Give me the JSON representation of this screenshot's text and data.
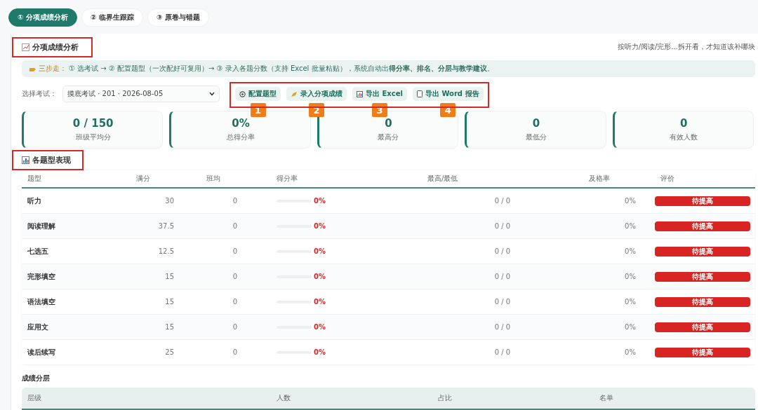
{
  "tabs": [
    {
      "label": "① 分项成绩分析",
      "selected": true
    },
    {
      "label": "② 临界生跟踪",
      "selected": false
    },
    {
      "label": "③ 原卷与错题",
      "selected": false
    }
  ],
  "panel": {
    "title": "分项成绩分析",
    "subtitle": "按听力/阅读/完形...拆开看，才知道该补哪块",
    "notice": {
      "lead": "三步走：",
      "text": "① 选考试 → ② 配置题型（一次配好可复用）→ ③ 录入各题分数（支持 Excel 批量粘贴），系统自动出**得分率、排名、分层与教学建议**。"
    },
    "exam_label": "选择考试：",
    "exam_value": "摸底考试 · 201 · 2026-08-05",
    "actions": [
      {
        "label": "配置题型",
        "kind": "config",
        "step": "1"
      },
      {
        "label": "录入分项成绩",
        "kind": "enter",
        "step": "2"
      },
      {
        "label": "导出 Excel",
        "kind": "excel",
        "step": "3"
      },
      {
        "label": "导出 Word 报告",
        "kind": "word",
        "step": "4"
      }
    ],
    "stats": [
      {
        "value": "0 / 150",
        "label": "班级平均分"
      },
      {
        "value": "0%",
        "label": "总得分率"
      },
      {
        "value": "0",
        "label": "最高分"
      },
      {
        "value": "0",
        "label": "最低分"
      },
      {
        "value": "0",
        "label": "有效人数"
      }
    ],
    "section_title": "各题型表现",
    "table": {
      "columns": [
        "题型",
        "满分",
        "班均",
        "得分率",
        "最高/最低",
        "及格率",
        "评价"
      ],
      "rows": [
        {
          "name": "听力",
          "full": "30",
          "avg": "0",
          "level": 0,
          "rate": "0%",
          "maxmin": "0 / 0",
          "pass": "0%",
          "verdict": "待提高"
        },
        {
          "name": "阅读理解",
          "full": "37.5",
          "avg": "0",
          "level": 0,
          "rate": "0%",
          "maxmin": "0 / 0",
          "pass": "0%",
          "verdict": "待提高"
        },
        {
          "name": "七选五",
          "full": "12.5",
          "avg": "0",
          "level": 0,
          "rate": "0%",
          "maxmin": "0 / 0",
          "pass": "0%",
          "verdict": "待提高"
        },
        {
          "name": "完形填空",
          "full": "15",
          "avg": "0",
          "level": 0,
          "rate": "0%",
          "maxmin": "0 / 0",
          "pass": "0%",
          "verdict": "待提高"
        },
        {
          "name": "语法填空",
          "full": "15",
          "avg": "0",
          "level": 0,
          "rate": "0%",
          "maxmin": "0 / 0",
          "pass": "0%",
          "verdict": "待提高"
        },
        {
          "name": "应用文",
          "full": "15",
          "avg": "0",
          "level": 0,
          "rate": "0%",
          "maxmin": "0 / 0",
          "pass": "0%",
          "verdict": "待提高"
        },
        {
          "name": "读后续写",
          "full": "25",
          "avg": "0",
          "level": 0,
          "rate": "0%",
          "maxmin": "0 / 0",
          "pass": "0%",
          "verdict": "待提高"
        }
      ]
    },
    "tiers": {
      "title": "成绩分层",
      "columns": [
        "层级",
        "人数",
        "占比",
        "名单"
      ]
    }
  }
}
